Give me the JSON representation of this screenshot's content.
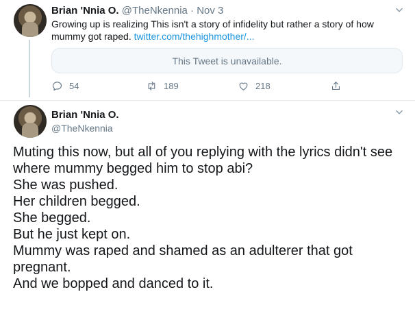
{
  "tweet1": {
    "name": "Brian 'Nnia O.",
    "handle": "@TheNkennia",
    "separator": "·",
    "date": "Nov 3",
    "text": "Growing up is realizing This isn't a story of infidelity but rather a story of how mummy got raped.",
    "link": "twitter.com/thehighmother/...",
    "quoted_unavailable": "This Tweet is unavailable.",
    "replies": "54",
    "retweets": "189",
    "likes": "218"
  },
  "tweet2": {
    "name": "Brian 'Nnia O.",
    "handle": "@TheNkennia",
    "lines": [
      "Muting this now, but all of you replying with the lyrics didn't see where mummy begged him to stop abi?",
      "She was pushed.",
      "Her children begged.",
      "She begged.",
      "But he just kept on.",
      "Mummy was raped and shamed as an adulterer that got pregnant.",
      "And we bopped and danced to it."
    ]
  },
  "icons": {
    "reply": "reply-icon",
    "retweet": "retweet-icon",
    "like": "heart-icon",
    "share": "share-icon",
    "caret": "chevron-down-icon"
  },
  "colors": {
    "link": "#1b95e0",
    "secondary_text": "#657786",
    "primary_text": "#14171a",
    "thread_line": "#ccd6dd"
  }
}
